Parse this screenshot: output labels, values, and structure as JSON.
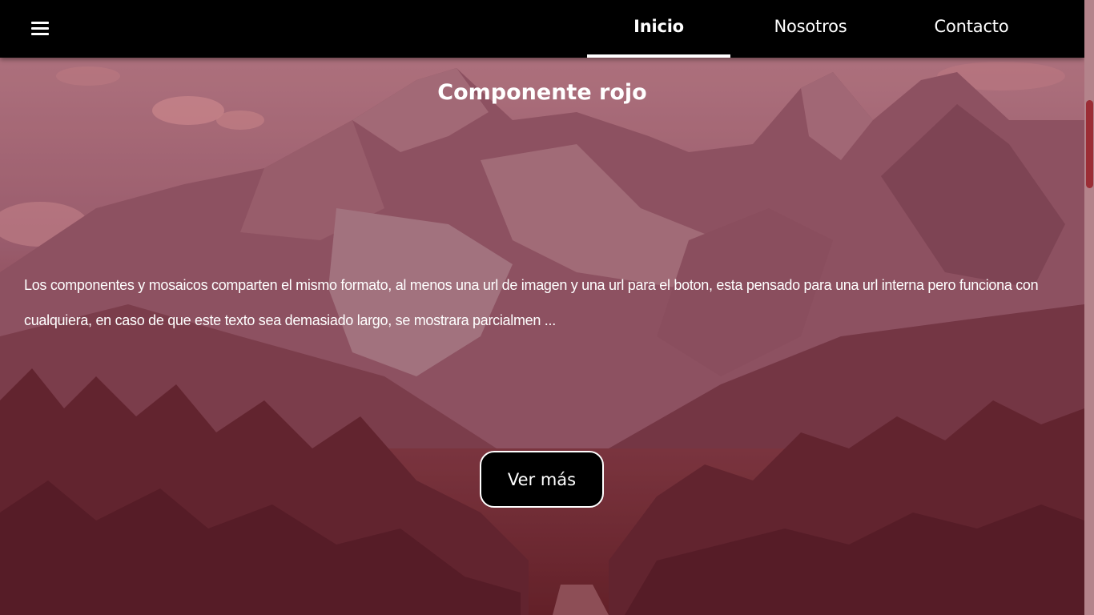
{
  "navbar": {
    "menu_icon": "hamburger-menu-icon",
    "links": [
      {
        "label": "Inicio",
        "active": true
      },
      {
        "label": "Nosotros",
        "active": false
      },
      {
        "label": "Contacto",
        "active": false
      }
    ]
  },
  "component": {
    "title": "Componente rojo",
    "text": "Los componentes y mosaicos comparten el mismo formato, al menos una url de imagen y una url para el boton, esta pensado para una url interna pero funciona con cualquiera, en caso de que este texto sea demasiado largo, se mostrara parcialmen ...",
    "button_label": "Ver más",
    "overlay_color": "#8b1a2a",
    "background_image": "mountain-forest-landscape"
  },
  "colors": {
    "navbar_bg": "#000000",
    "button_bg": "#000000",
    "text": "#ffffff",
    "scrollbar_track": "#b4838b",
    "scrollbar_thumb": "#9b2d35"
  }
}
